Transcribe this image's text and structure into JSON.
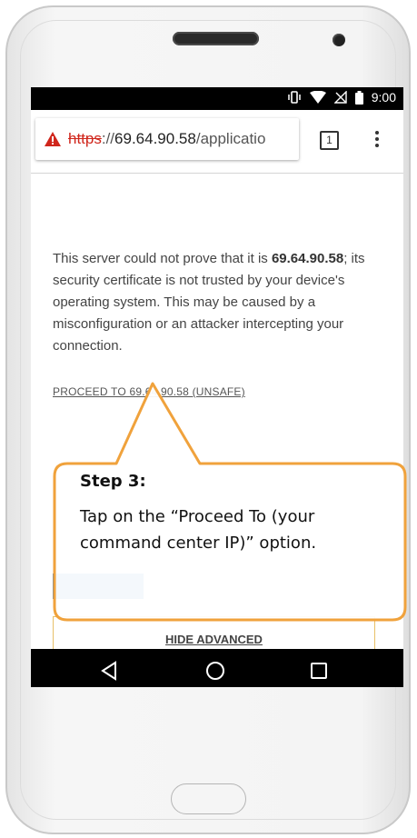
{
  "status_bar": {
    "time": "9:00",
    "icons": [
      "vibrate-icon",
      "wifi-icon",
      "no-sim-icon",
      "battery-icon"
    ]
  },
  "url_bar": {
    "scheme": "https",
    "separator": "://",
    "host": "69.64.90.58",
    "path": "/applicatio",
    "tab_count": "1"
  },
  "warning_page": {
    "message_prefix": "This server could not prove that it is ",
    "message_host": "69.64.90.58",
    "message_suffix": "; its security certificate is not trusted by your device's operating system. This may be caused by a misconfiguration or an attacker intercepting your connection.",
    "proceed_link": "PROCEED TO 69.64.90.58 (UNSAFE)",
    "hide_advanced": "HIDE ADVANCED"
  },
  "callout": {
    "title": "Step 3:",
    "body": "Tap on the “Proceed To (your command center IP)” option."
  },
  "colors": {
    "warning_red": "#d0261c",
    "callout_border": "#f0a23c",
    "primary_button": "#4a84c9"
  }
}
